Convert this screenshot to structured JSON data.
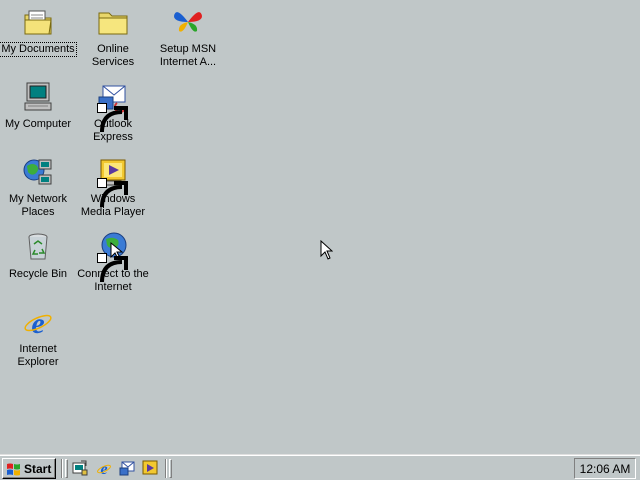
{
  "desktop": {
    "icons": [
      {
        "label": "My Documents",
        "icon": "my-documents-icon"
      },
      {
        "label": "My Computer",
        "icon": "my-computer-icon"
      },
      {
        "label": "My Network Places",
        "icon": "network-places-icon"
      },
      {
        "label": "Recycle Bin",
        "icon": "recycle-bin-icon"
      },
      {
        "label": "Internet Explorer",
        "icon": "internet-explorer-icon"
      },
      {
        "label": "Online Services",
        "icon": "folder-icon"
      },
      {
        "label": "Outlook Express",
        "icon": "outlook-express-icon"
      },
      {
        "label": "Windows Media Player",
        "icon": "media-player-icon"
      },
      {
        "label": "Connect to the Internet",
        "icon": "connect-internet-icon"
      },
      {
        "label": "Setup MSN Internet A...",
        "icon": "msn-butterfly-icon"
      }
    ]
  },
  "taskbar": {
    "start_label": "Start",
    "quick_launch": [
      {
        "icon": "show-desktop-icon"
      },
      {
        "icon": "internet-explorer-icon"
      },
      {
        "icon": "outlook-express-icon"
      },
      {
        "icon": "media-player-icon"
      }
    ],
    "clock": "12:06 AM"
  },
  "colors": {
    "desktop_bg": "#c0c7c8",
    "taskbar_bg": "#c0c7c8"
  }
}
